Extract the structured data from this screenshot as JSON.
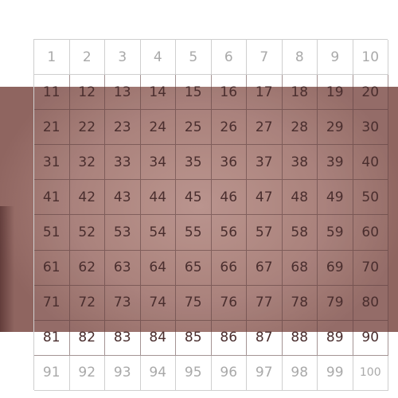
{
  "grid": {
    "columns": 10,
    "rows": 10,
    "numbers": [
      "1",
      "2",
      "3",
      "4",
      "5",
      "6",
      "7",
      "8",
      "9",
      "10",
      "11",
      "12",
      "13",
      "14",
      "15",
      "16",
      "17",
      "18",
      "19",
      "20",
      "21",
      "22",
      "23",
      "24",
      "25",
      "26",
      "27",
      "28",
      "29",
      "30",
      "31",
      "32",
      "33",
      "34",
      "35",
      "36",
      "37",
      "38",
      "39",
      "40",
      "41",
      "42",
      "43",
      "44",
      "45",
      "46",
      "47",
      "48",
      "49",
      "50",
      "51",
      "52",
      "53",
      "54",
      "55",
      "56",
      "57",
      "58",
      "59",
      "60",
      "61",
      "62",
      "63",
      "64",
      "65",
      "66",
      "67",
      "68",
      "69",
      "70",
      "71",
      "72",
      "73",
      "74",
      "75",
      "76",
      "77",
      "78",
      "79",
      "80",
      "81",
      "82",
      "83",
      "84",
      "85",
      "86",
      "87",
      "88",
      "89",
      "90",
      "91",
      "92",
      "93",
      "94",
      "95",
      "96",
      "97",
      "98",
      "99",
      "100"
    ]
  },
  "colors": {
    "grid_line": "#cfcfcf",
    "number_text_light": "#a9a9a9",
    "number_text_dark": "#4a2e2e",
    "photo_tone": "#a67c76"
  }
}
